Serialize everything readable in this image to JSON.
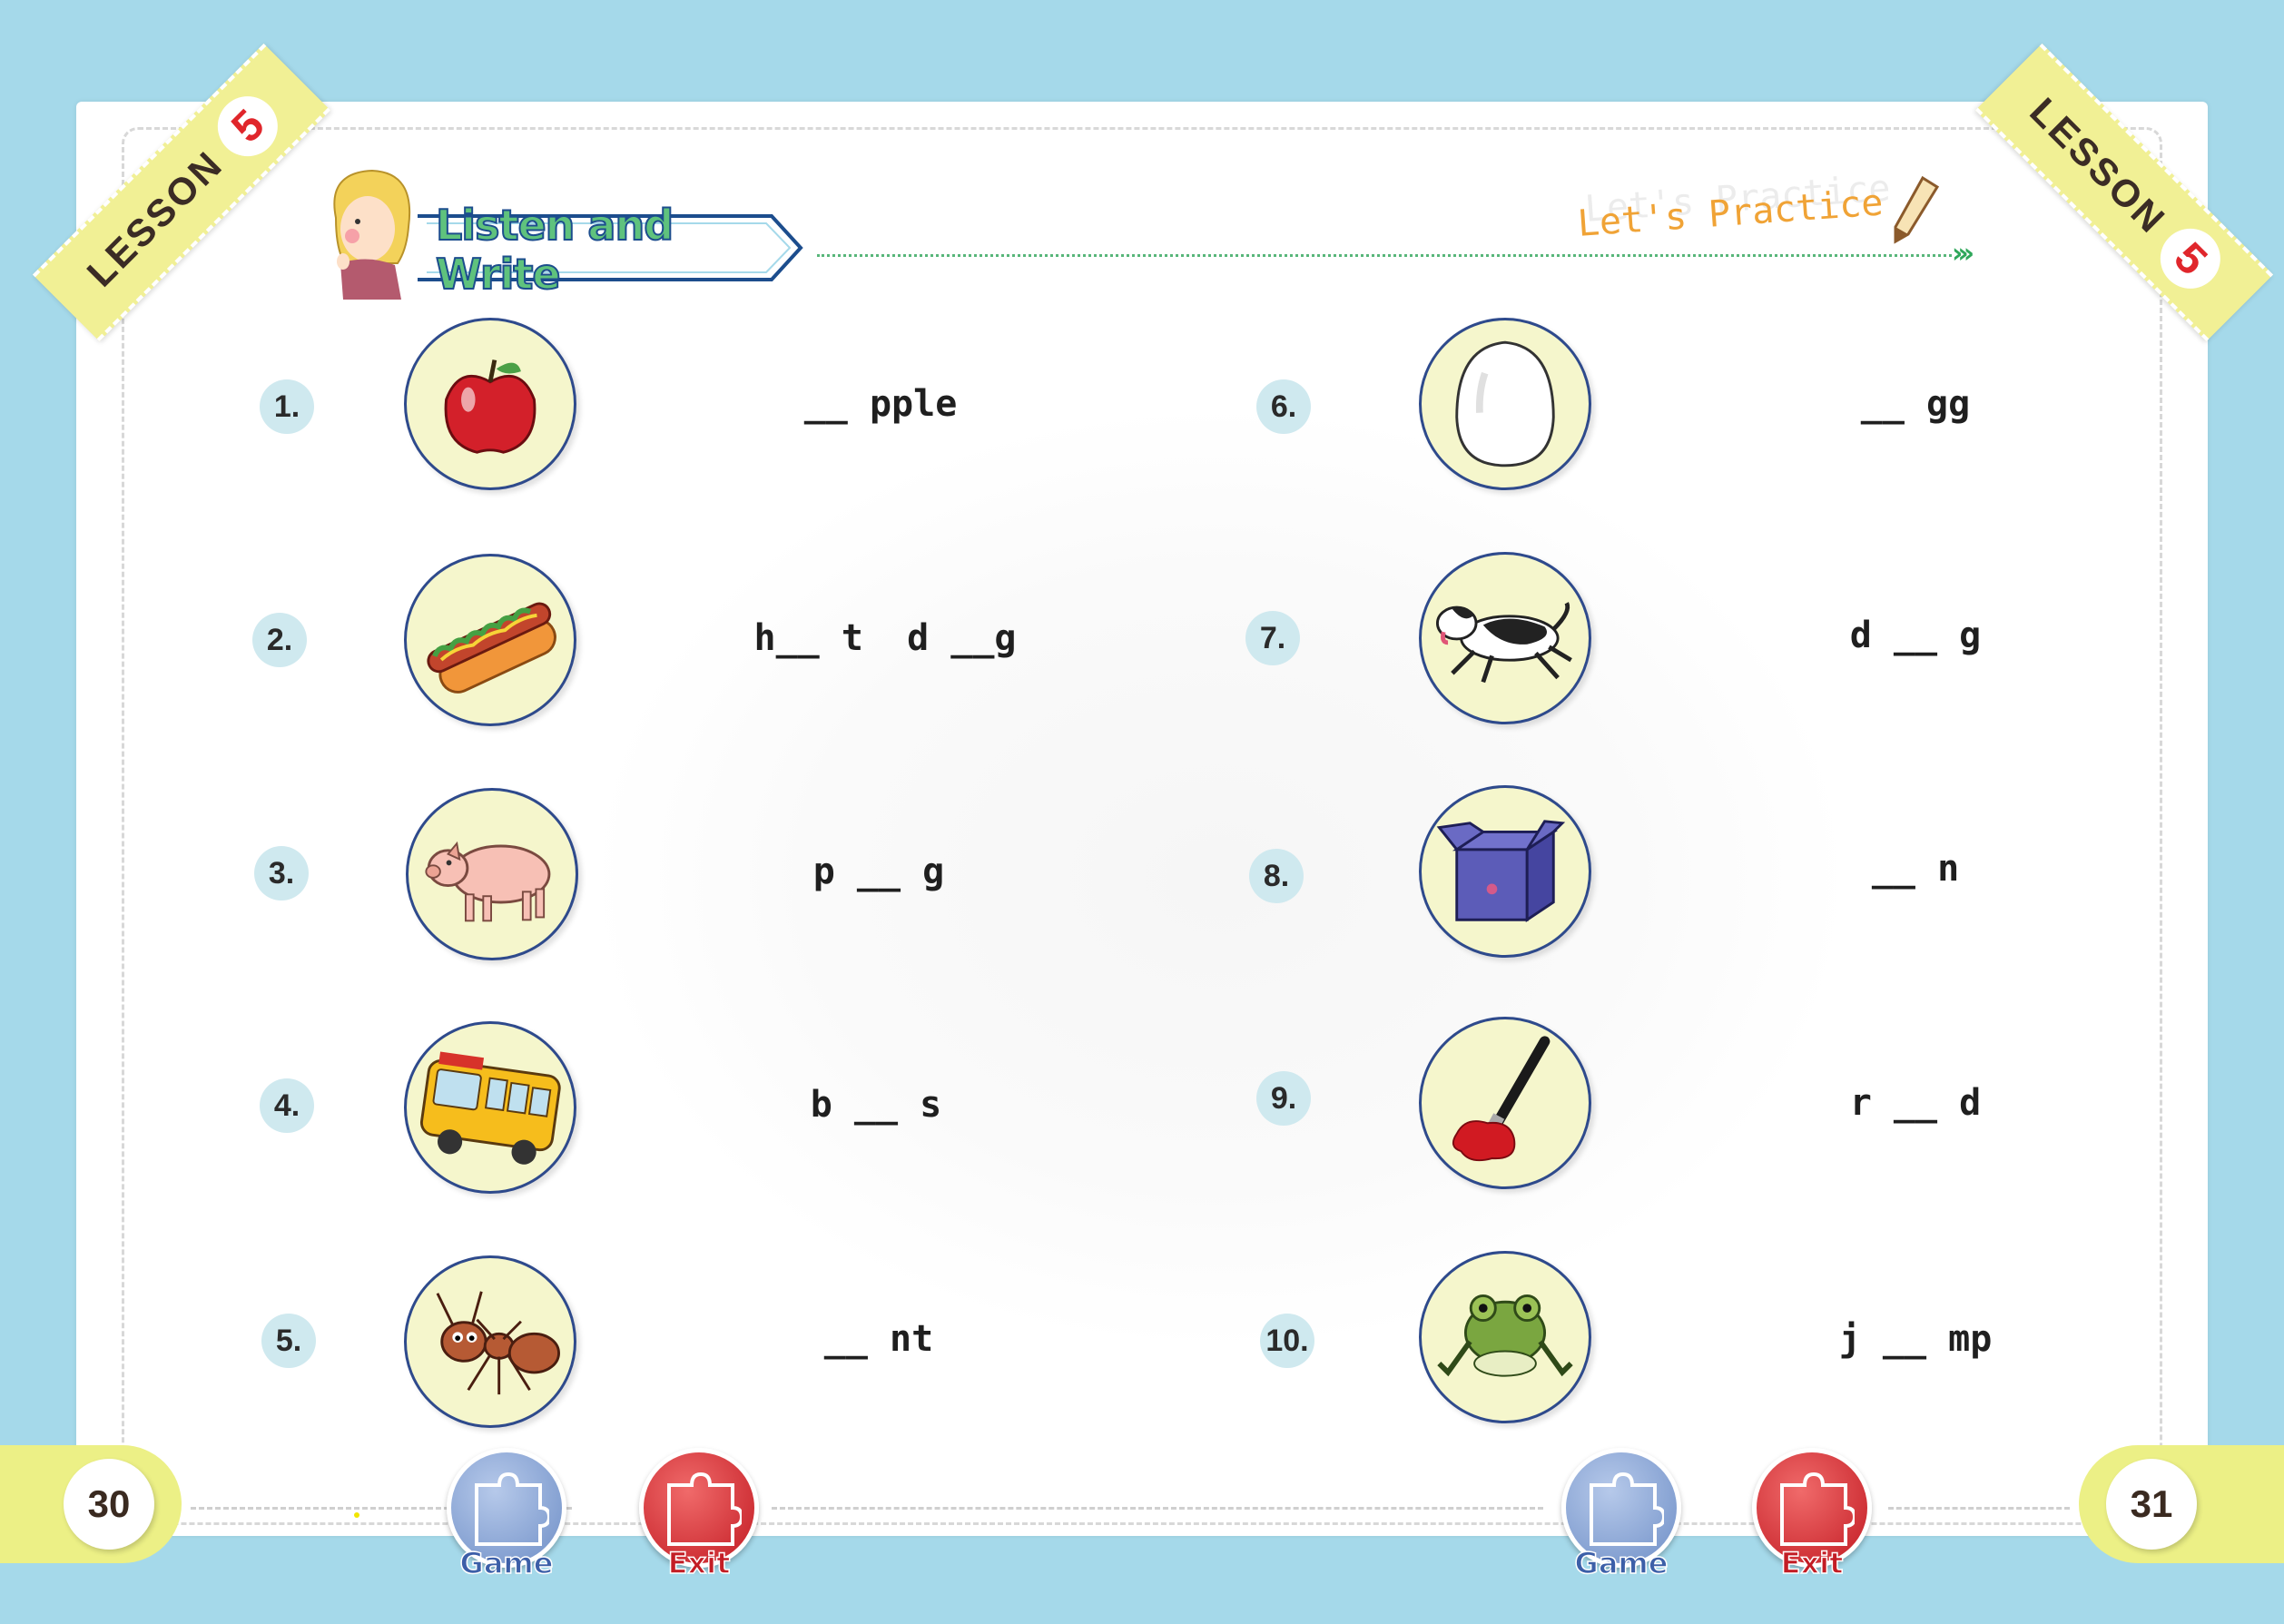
{
  "ribbons": {
    "left": {
      "text": "LESSON",
      "number": "5"
    },
    "right": {
      "text": "LESSON",
      "number": "5"
    }
  },
  "header": {
    "title": "Listen and Write",
    "practice": "Let's Practice"
  },
  "items": [
    {
      "num": "1.",
      "word": "__ pple",
      "icon": "apple-icon"
    },
    {
      "num": "2.",
      "word": "h__ t  d __g",
      "icon": "hotdog-icon"
    },
    {
      "num": "3.",
      "word": "p __ g",
      "icon": "pig-icon"
    },
    {
      "num": "4.",
      "word": "b __ s",
      "icon": "bus-icon"
    },
    {
      "num": "5.",
      "word": "__ nt",
      "icon": "ant-icon"
    },
    {
      "num": "6.",
      "word": "__ gg",
      "icon": "egg-icon"
    },
    {
      "num": "7.",
      "word": "d __ g",
      "icon": "dog-icon"
    },
    {
      "num": "8.",
      "word": "__ n",
      "icon": "box-icon"
    },
    {
      "num": "9.",
      "word": "r __ d",
      "icon": "red-paint-icon"
    },
    {
      "num": "10.",
      "word": "j __ mp",
      "icon": "frog-jump-icon"
    }
  ],
  "footer": {
    "left_page": "30",
    "right_page": "31",
    "game_label": "Game",
    "exit_label": "Exit"
  },
  "colors": {
    "background": "#a5d9ea",
    "ribbon": "#f1f095",
    "circle_fill": "#f5f6cc",
    "circle_border": "#2e4a8c",
    "number_badge": "#cfe9ef",
    "title_green": "#5fc27d",
    "practice_orange": "#f0a336",
    "game_blue": "#6f8fc7",
    "exit_red": "#c21a22"
  }
}
